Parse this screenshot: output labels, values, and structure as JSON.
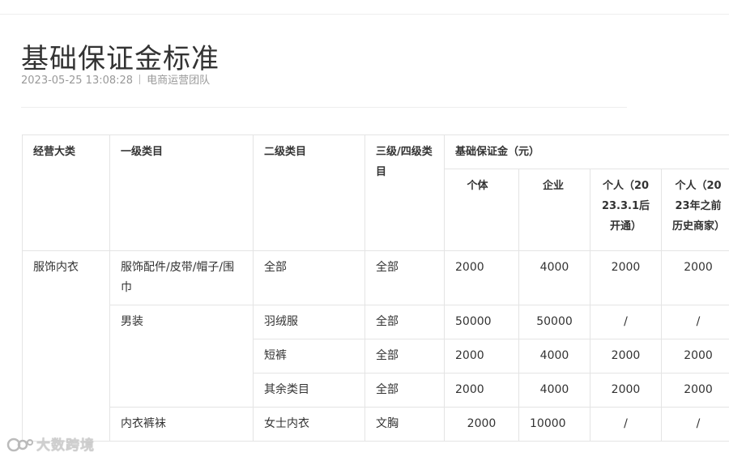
{
  "article": {
    "title": "基础保证金标准",
    "date": "2023-05-25 13:08:28",
    "author": "电商运营团队"
  },
  "table": {
    "headers": {
      "category": "经营大类",
      "level1": "一级类目",
      "level2": "二级类目",
      "level34": "三级/四级类目",
      "deposit": "基础保证金（元）",
      "individual": "个体",
      "enterprise": "企业",
      "person_new": "个人（2023.3.1后开通）",
      "person_old": "个人（2023年之前历史商家）"
    },
    "rows": [
      {
        "category": "服饰内衣",
        "level1": "服饰配件/皮带/帽子/围巾",
        "level2": "全部",
        "level34": "全部",
        "individual": "2000",
        "enterprise": "4000",
        "person_new": "2000",
        "person_old": "2000"
      },
      {
        "level1": "男装",
        "level2": "羽绒服",
        "level34": "全部",
        "individual": "50000",
        "enterprise": "50000",
        "person_new": "/",
        "person_old": "/"
      },
      {
        "level2": "短裤",
        "level34": "全部",
        "individual": "2000",
        "enterprise": "4000",
        "person_new": "2000",
        "person_old": "2000"
      },
      {
        "level2": "其余类目",
        "level34": "全部",
        "individual": "2000",
        "enterprise": "4000",
        "person_new": "2000",
        "person_old": "2000"
      },
      {
        "level1": "内衣裤袜",
        "level2": "女士内衣",
        "level34": "文胸",
        "individual": "2000",
        "enterprise": "10000",
        "person_new": "/",
        "person_old": "/"
      }
    ]
  },
  "watermark": {
    "text": "大数跨境"
  }
}
